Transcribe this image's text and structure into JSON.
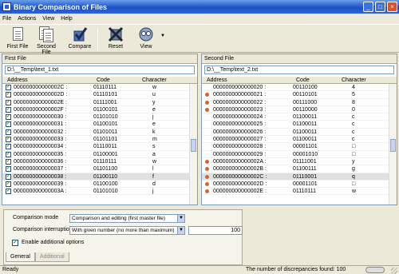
{
  "window": {
    "title": "Binary Comparison of Files",
    "minimize": "_",
    "maximize": "□",
    "close": "×"
  },
  "menu": [
    "File",
    "Actions",
    "View",
    "Help"
  ],
  "toolbar": {
    "first_file": "First File",
    "second_file": "Second File",
    "compare": "Compare",
    "reset": "Reset",
    "view": "View"
  },
  "left_pane": {
    "header": "First File",
    "path": "D:\\__Temp\\text_1.txt",
    "columns": {
      "address": "Address",
      "code": "Code",
      "character": "Character"
    },
    "rows": [
      {
        "marker": "check",
        "address": "000000000000002C :",
        "code": "01110111",
        "char": "w"
      },
      {
        "marker": "check",
        "address": "000000000000002D :",
        "code": "01110101",
        "char": "u"
      },
      {
        "marker": "check",
        "address": "000000000000002E :",
        "code": "01111001",
        "char": "y"
      },
      {
        "marker": "check",
        "address": "000000000000002F :",
        "code": "01100101",
        "char": "e"
      },
      {
        "marker": "check",
        "address": "0000000000000030 :",
        "code": "01101010",
        "char": "j"
      },
      {
        "marker": "check",
        "address": "0000000000000031 :",
        "code": "01100101",
        "char": "e"
      },
      {
        "marker": "check",
        "address": "0000000000000032 :",
        "code": "01101011",
        "char": "k"
      },
      {
        "marker": "check",
        "address": "0000000000000033 :",
        "code": "01101101",
        "char": "m"
      },
      {
        "marker": "check",
        "address": "0000000000000034 :",
        "code": "01110011",
        "char": "s"
      },
      {
        "marker": "check",
        "address": "0000000000000035 :",
        "code": "01100001",
        "char": "a"
      },
      {
        "marker": "check",
        "address": "0000000000000036 :",
        "code": "01110111",
        "char": "w"
      },
      {
        "marker": "check",
        "address": "0000000000000037 :",
        "code": "01101100",
        "char": "l"
      },
      {
        "marker": "check",
        "address": "0000000000000038 :",
        "code": "01100110",
        "char": "f"
      },
      {
        "marker": "check",
        "address": "0000000000000039 :",
        "code": "01100100",
        "char": "d"
      },
      {
        "marker": "check",
        "address": "000000000000003A :",
        "code": "01101010",
        "char": "j"
      }
    ]
  },
  "right_pane": {
    "header": "Second File",
    "path": "D:\\__Temp\\text_2.txt",
    "columns": {
      "address": "Address",
      "code": "Code",
      "character": "Character"
    },
    "rows": [
      {
        "marker": "none",
        "address": "0000000000000020 :",
        "code": "00110100",
        "char": "4"
      },
      {
        "marker": "dot",
        "address": "0000000000000021 :",
        "code": "00110101",
        "char": "5"
      },
      {
        "marker": "dot",
        "address": "0000000000000022 :",
        "code": "00111000",
        "char": "8"
      },
      {
        "marker": "dot",
        "address": "0000000000000023 :",
        "code": "00110000",
        "char": "0"
      },
      {
        "marker": "none",
        "address": "0000000000000024 :",
        "code": "01100011",
        "char": "c"
      },
      {
        "marker": "none",
        "address": "0000000000000025 :",
        "code": "01100011",
        "char": "c"
      },
      {
        "marker": "none",
        "address": "0000000000000026 :",
        "code": "01100011",
        "char": "c"
      },
      {
        "marker": "none",
        "address": "0000000000000027 :",
        "code": "01100011",
        "char": "c"
      },
      {
        "marker": "none",
        "address": "0000000000000028 :",
        "code": "00001101",
        "char": "□"
      },
      {
        "marker": "none",
        "address": "0000000000000029 :",
        "code": "00001010",
        "char": "□"
      },
      {
        "marker": "dot",
        "address": "000000000000002A :",
        "code": "01111001",
        "char": "y"
      },
      {
        "marker": "dot",
        "address": "000000000000002B :",
        "code": "01100111",
        "char": "g"
      },
      {
        "marker": "dot",
        "address": "000000000000002C :",
        "code": "01110001",
        "char": "q"
      },
      {
        "marker": "dot",
        "address": "000000000000002D :",
        "code": "00001101",
        "char": "□"
      },
      {
        "marker": "dot",
        "address": "000000000000002E :",
        "code": "01110111",
        "char": "w"
      }
    ]
  },
  "options": {
    "mode_label": "Comparison mode",
    "mode_value": "Comparison and editing (first master file)",
    "interrupt_label": "Comparison interruption",
    "interrupt_value": "With given number (no more than maximum)",
    "interrupt_number": "100",
    "enable_label": "Enable additional options",
    "enable_checked": true
  },
  "tabs": [
    "General",
    "Additional"
  ],
  "status": {
    "left": "Ready",
    "right": "The number of discrepancies found: 100"
  }
}
